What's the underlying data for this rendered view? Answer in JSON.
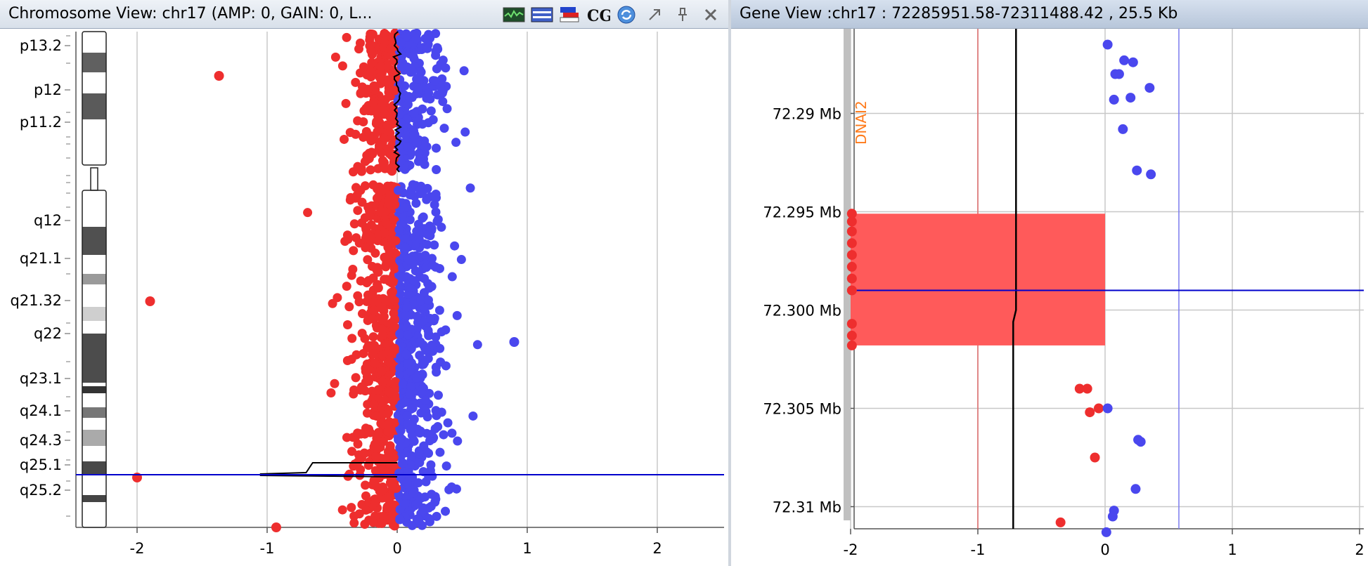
{
  "left_panel": {
    "title": "Chromosome View: chr17 (AMP: 0, GAIN: 0, L...",
    "toolbar_icons": [
      "chart-icon",
      "list-icon",
      "color-settings-icon",
      "cgh-icon",
      "refresh-icon",
      "undock-icon",
      "pin-icon",
      "close-icon"
    ],
    "cgh_label": "CGH"
  },
  "right_panel": {
    "title": "Gene View :chr17 : 72285951.58-72311488.42 , 25.5 Kb"
  },
  "colors": {
    "loss": "#ee2e2e",
    "gain": "#4a47ee",
    "highlight_region": "#ff5a5a",
    "cursor_line": "#0000cc"
  },
  "chart_data": [
    {
      "type": "scatter",
      "name": "chromosome-view",
      "xticks": [
        "-2",
        "-1",
        "0",
        "1",
        "2"
      ],
      "xlim": [
        -2.25,
        2.25
      ],
      "bands": [
        "p13.2",
        "p12",
        "p11.2",
        "q12",
        "q21.1",
        "q21.32",
        "q22",
        "q23.1",
        "q24.1",
        "q24.3",
        "q25.1",
        "q25.2"
      ],
      "outliers_loss": [
        [
          -1.37,
          "p13.2-p12"
        ],
        [
          -1.9,
          "q21.32"
        ],
        [
          -2.0,
          "q25.1"
        ],
        [
          -0.93,
          "q25.3"
        ]
      ],
      "outliers_gain": [
        [
          0.9,
          "q22"
        ]
      ],
      "cursor_band": "q25.1",
      "grid": true
    },
    {
      "type": "scatter",
      "name": "gene-view",
      "gene_label": "DNAI2",
      "xticks": [
        "-2",
        "-1",
        "0",
        "1",
        "2"
      ],
      "yticks": [
        "72.29 Mb",
        "72.295 Mb",
        "72.300 Mb",
        "72.305 Mb",
        "72.31 Mb"
      ],
      "ylim": [
        72.2867,
        72.3125
      ],
      "xlim": [
        -2.2,
        2.2
      ],
      "loss_points": [
        [
          -1.99,
          72.2951
        ],
        [
          -1.99,
          72.2955
        ],
        [
          -1.99,
          72.296
        ],
        [
          -1.99,
          72.2966
        ],
        [
          -1.99,
          72.2972
        ],
        [
          -1.99,
          72.2978
        ],
        [
          -1.99,
          72.2984
        ],
        [
          -1.99,
          72.299
        ],
        [
          -1.99,
          72.3007
        ],
        [
          -1.99,
          72.3013
        ],
        [
          -1.99,
          72.3018
        ],
        [
          -0.2,
          72.304
        ],
        [
          -0.14,
          72.304
        ],
        [
          -0.12,
          72.3052
        ],
        [
          -0.05,
          72.305
        ],
        [
          -0.08,
          72.3075
        ],
        [
          -0.35,
          72.3108
        ]
      ],
      "gain_points": [
        [
          0.02,
          72.2865
        ],
        [
          0.15,
          72.2873
        ],
        [
          0.22,
          72.2874
        ],
        [
          0.08,
          72.288
        ],
        [
          0.11,
          72.288
        ],
        [
          0.35,
          72.2887
        ],
        [
          0.07,
          72.2893
        ],
        [
          0.2,
          72.2892
        ],
        [
          0.14,
          72.2908
        ],
        [
          0.25,
          72.2929
        ],
        [
          0.36,
          72.2931
        ],
        [
          0.02,
          72.305
        ],
        [
          0.26,
          72.3066
        ],
        [
          0.28,
          72.3067
        ],
        [
          0.24,
          72.3091
        ],
        [
          0.07,
          72.3102
        ],
        [
          0.06,
          72.3105
        ],
        [
          0.01,
          72.3113
        ]
      ],
      "region": {
        "x0": -2,
        "x1": 0,
        "y0": 72.2951,
        "y1": 72.3018
      },
      "threshold_loss": -1.0,
      "threshold_gain": 0.58,
      "moving_avg_x": -0.7,
      "cursor_y": 72.299,
      "grid": true
    }
  ]
}
